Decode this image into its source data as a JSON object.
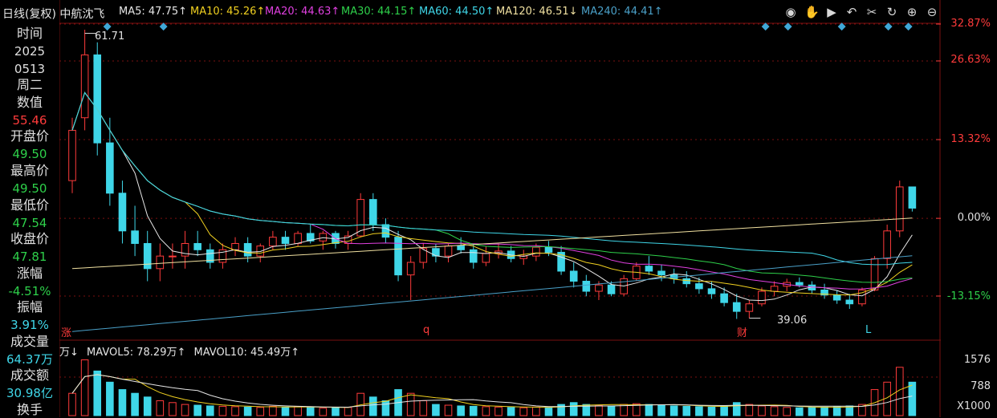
{
  "window": {
    "stock_title": "日线(复权)",
    "stock_name": "中航沈飞"
  },
  "ma_legend": [
    {
      "label": "MA5: 47.75↑",
      "color": "#e6e6e6"
    },
    {
      "label": "MA10: 45.26↑",
      "color": "#f0d020"
    },
    {
      "label": "MA20: 44.63↑",
      "color": "#e040e0"
    },
    {
      "label": "MA30: 44.15↑",
      "color": "#2ed04a"
    },
    {
      "label": "MA60: 44.50↑",
      "color": "#3fd6e8"
    },
    {
      "label": "MA120: 46.51↓",
      "color": "#f0e0a0"
    },
    {
      "label": "MA240: 44.41↑",
      "color": "#4aa0c8"
    }
  ],
  "toolbar_icons": [
    "eye-icon",
    "hand-icon",
    "play-icon",
    "undo-icon",
    "scissors-icon",
    "redo-icon",
    "zoom-in-icon",
    "zoom-out-icon"
  ],
  "sidebar": {
    "time_label": "时间",
    "year": "2025",
    "date": "0513",
    "weekday": "周二",
    "value_label": "数值",
    "value": "55.46",
    "open_label": "开盘价",
    "open": "49.50",
    "high_label": "最高价",
    "high": "49.50",
    "low_label": "最低价",
    "low": "47.54",
    "close_label": "收盘价",
    "close": "47.81",
    "change_label": "涨幅",
    "change": "-4.51%",
    "amplitude_label": "振幅",
    "amplitude": "3.91%",
    "volume_label": "成交量",
    "volume": "64.37万",
    "amount_label": "成交额",
    "amount": "30.98亿",
    "turnover_label": "换手"
  },
  "right_axis": {
    "price_pct_labels": [
      "32.87%",
      "26.63%",
      "13.32%",
      "0.00%",
      "-13.15%"
    ],
    "volume_labels": [
      "1576",
      "788",
      "X1000"
    ]
  },
  "chart_annotations": {
    "high_price_label": "61.71",
    "low_price_label": "39.06",
    "marker_left": "涨",
    "marker_q": "q",
    "marker_cai": "财",
    "marker_l": "L"
  },
  "volume_header": {
    "unit": "万↓",
    "mavol5": "MAVOL5: 78.29万↑",
    "mavol10": "MAVOL10: 45.49万↑"
  },
  "colors": {
    "up": "#ff3b3b",
    "down": "#3fd6e8",
    "grid_red": "#7a1010",
    "axis_red": "#ff3b3b"
  },
  "chart_data": {
    "type": "candlestick",
    "scale_pct": [
      -13.15,
      32.87
    ],
    "base_price": 47.0,
    "price_low": 39.06,
    "price_high": 61.71,
    "volume_max": 1576,
    "candles": [
      [
        50,
        55,
        49,
        54,
        600
      ],
      [
        55,
        62,
        54,
        60,
        1500
      ],
      [
        60,
        61,
        52,
        53,
        1200
      ],
      [
        53,
        55,
        48,
        49,
        900
      ],
      [
        49,
        50,
        45,
        46,
        700
      ],
      [
        46,
        48,
        44,
        45,
        600
      ],
      [
        45,
        46,
        42,
        43,
        500
      ],
      [
        43,
        45,
        42,
        44,
        400
      ],
      [
        44,
        45,
        43,
        44,
        350
      ],
      [
        44,
        46,
        43,
        45,
        300
      ],
      [
        45,
        46,
        44,
        44.5,
        280
      ],
      [
        44.5,
        45,
        43,
        43.5,
        260
      ],
      [
        43.5,
        45,
        43,
        44.5,
        250
      ],
      [
        44.5,
        45.5,
        44,
        45,
        240
      ],
      [
        45,
        45.5,
        43.5,
        44,
        230
      ],
      [
        44,
        45,
        43.5,
        44.8,
        220
      ],
      [
        44.8,
        46,
        44.5,
        45.5,
        250
      ],
      [
        45.5,
        46,
        44.5,
        45,
        230
      ],
      [
        45,
        46,
        44.8,
        45.8,
        240
      ],
      [
        45.8,
        46.5,
        45,
        45.2,
        220
      ],
      [
        45.2,
        46,
        44.5,
        45.8,
        200
      ],
      [
        45.8,
        46,
        44.6,
        45,
        210
      ],
      [
        45,
        46,
        44.5,
        45.6,
        220
      ],
      [
        45.6,
        49,
        45.5,
        48.5,
        600
      ],
      [
        48.5,
        49,
        46,
        46.5,
        500
      ],
      [
        46.5,
        47,
        45,
        45.5,
        400
      ],
      [
        45.5,
        46,
        42,
        42.5,
        700
      ],
      [
        42.5,
        44,
        40.5,
        43.5,
        600
      ],
      [
        43.5,
        45,
        43,
        44.6,
        400
      ],
      [
        44.6,
        45,
        43.5,
        44,
        300
      ],
      [
        44,
        45,
        43.5,
        44.8,
        280
      ],
      [
        44.8,
        45.5,
        44.2,
        44.5,
        260
      ],
      [
        44.5,
        45,
        43,
        43.5,
        250
      ],
      [
        43.5,
        44.8,
        43.2,
        44.2,
        240
      ],
      [
        44.2,
        45,
        43.8,
        44.4,
        230
      ],
      [
        44.4,
        44.8,
        43.5,
        43.8,
        220
      ],
      [
        43.8,
        44.5,
        43.3,
        44,
        210
      ],
      [
        44,
        45,
        43.6,
        44.7,
        230
      ],
      [
        44.7,
        45.2,
        44,
        44.3,
        220
      ],
      [
        44.3,
        44.8,
        42.5,
        42.8,
        300
      ],
      [
        42.8,
        43.5,
        41.5,
        42,
        350
      ],
      [
        42,
        42.5,
        40.8,
        41.2,
        300
      ],
      [
        41.2,
        42,
        40.5,
        41.7,
        280
      ],
      [
        41.7,
        42,
        40.8,
        41,
        260
      ],
      [
        41,
        42.5,
        40.8,
        42.2,
        300
      ],
      [
        42.2,
        43.5,
        42,
        43.2,
        320
      ],
      [
        43.2,
        44,
        42.5,
        42.8,
        300
      ],
      [
        42.8,
        43.3,
        42,
        42.5,
        280
      ],
      [
        42.5,
        43,
        41.8,
        42.2,
        260
      ],
      [
        42.2,
        42.8,
        41.5,
        41.8,
        250
      ],
      [
        41.8,
        42.3,
        41,
        41.4,
        240
      ],
      [
        41.4,
        42,
        40.6,
        41,
        230
      ],
      [
        41,
        41.5,
        40,
        40.3,
        260
      ],
      [
        40.3,
        41,
        39,
        39.6,
        350
      ],
      [
        39.6,
        40.5,
        39.06,
        40.2,
        300
      ],
      [
        40.2,
        41.5,
        40,
        41.2,
        260
      ],
      [
        41.2,
        42,
        40.8,
        41.6,
        240
      ],
      [
        41.6,
        42.2,
        41.2,
        41.9,
        220
      ],
      [
        41.9,
        42.3,
        41.5,
        41.7,
        210
      ],
      [
        41.7,
        42,
        41,
        41.3,
        220
      ],
      [
        41.3,
        41.8,
        40.6,
        40.9,
        230
      ],
      [
        40.9,
        41.3,
        40.2,
        40.5,
        240
      ],
      [
        40.5,
        41,
        39.8,
        40.2,
        260
      ],
      [
        40.2,
        41.5,
        40,
        41.3,
        300
      ],
      [
        41.3,
        44,
        41.2,
        43.8,
        700
      ],
      [
        43.8,
        46.5,
        43,
        46,
        900
      ],
      [
        46,
        50,
        45.5,
        49.5,
        1300
      ],
      [
        49.5,
        49.5,
        47.54,
        47.81,
        900
      ]
    ]
  }
}
